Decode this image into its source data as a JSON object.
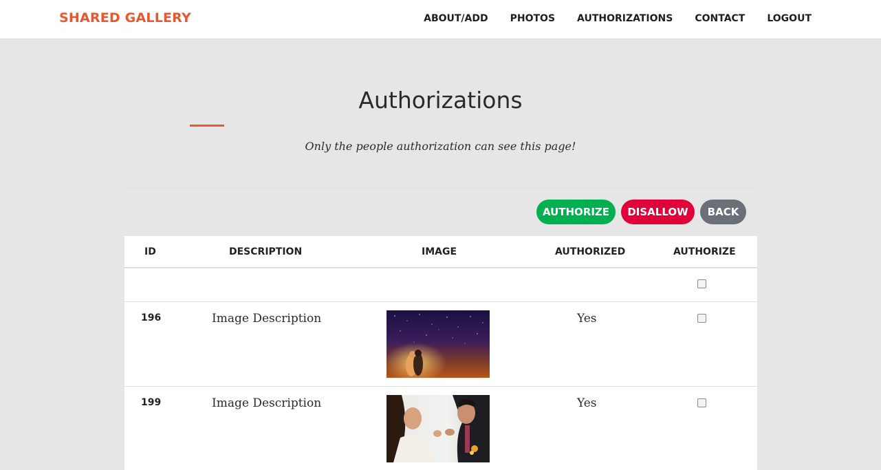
{
  "navbar": {
    "brand": "SHARED GALLERY",
    "links": [
      "ABOUT/ADD",
      "PHOTOS",
      "AUTHORIZATIONS",
      "CONTACT",
      "LOGOUT"
    ]
  },
  "page": {
    "title": "Authorizations",
    "subtitle": "Only the people authorization can see this page!"
  },
  "actions": {
    "authorize_label": "AUTHORIZE",
    "disallow_label": "DISALLOW",
    "back_label": "BACK"
  },
  "colors": {
    "brand": "#e8572f",
    "authorize": "#00b050",
    "disallow": "#e0003a",
    "back": "#6b6f78",
    "page_background": "#e6e6e6"
  },
  "table": {
    "headers": [
      "ID",
      "DESCRIPTION",
      "IMAGE",
      "AUTHORIZED",
      "AUTHORIZE"
    ],
    "rows": [
      {
        "id": "196",
        "description": "Image Description",
        "image": "starry-night-couple-photo",
        "authorized": "Yes",
        "checked": false
      },
      {
        "id": "199",
        "description": "Image Description",
        "image": "couple-feeding-cake-photo",
        "authorized": "Yes",
        "checked": false
      }
    ]
  }
}
